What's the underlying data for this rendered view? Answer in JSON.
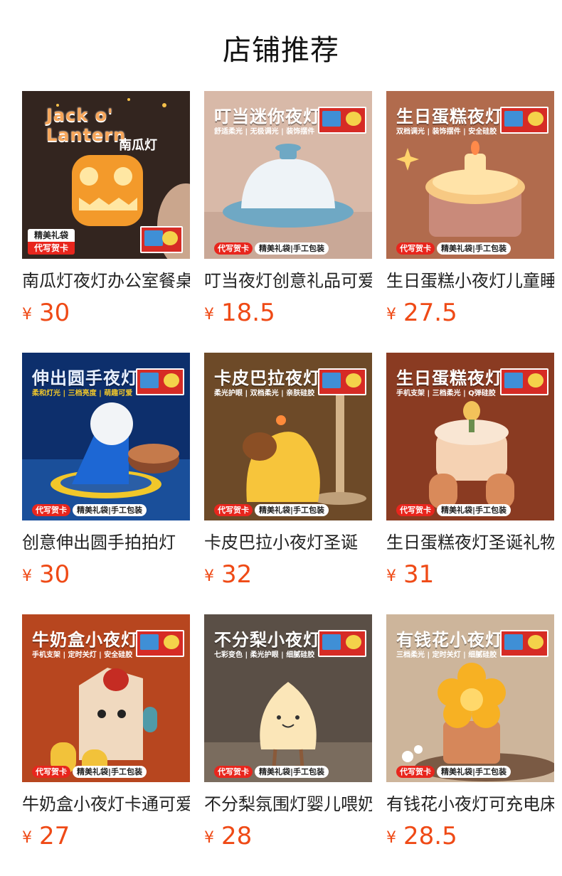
{
  "page": {
    "title": "店铺推荐"
  },
  "common": {
    "currency": "¥",
    "tag_red": "代写贺卡",
    "tag_white": "精美礼袋|手工包装",
    "tag1_top": "精美礼袋",
    "tag1_bottom": "代写贺卡"
  },
  "products": [
    {
      "name": "南瓜灯夜灯办公室餐桌",
      "price": "30",
      "headline": "Jack o' Lantern",
      "subline": "南瓜灯",
      "colors": {
        "bg": "#3a2a22",
        "accent": "#f39a2b"
      }
    },
    {
      "name": "叮当夜灯创意礼品可爱",
      "price": "18.5",
      "headline": "叮当迷你夜灯",
      "subline": "舒适柔光 | 无极调光 | 装饰摆件",
      "colors": {
        "bg": "#d9b7a6",
        "accent": "#6fa8c4"
      }
    },
    {
      "name": "生日蛋糕小夜灯儿童睡",
      "price": "27.5",
      "headline": "生日蛋糕夜灯",
      "subline": "双档调光 | 装饰摆件 | 安全硅胶",
      "colors": {
        "bg": "#b36a4b",
        "accent": "#f7c983"
      }
    },
    {
      "name": "创意伸出圆手拍拍灯",
      "price": "30",
      "headline": "伸出圆手夜灯",
      "subline": "柔和灯光 | 三档亮度 | 萌趣可爱",
      "colors": {
        "bg": "#0e2f6b",
        "accent": "#1d67d4"
      }
    },
    {
      "name": "卡皮巴拉小夜灯圣诞",
      "price": "32",
      "headline": "卡皮巴拉夜灯",
      "subline": "柔光护眼 | 双档柔光 | 亲肤硅胶",
      "colors": {
        "bg": "#6e4a25",
        "accent": "#f3c23b"
      }
    },
    {
      "name": "生日蛋糕夜灯圣诞礼物",
      "price": "31",
      "headline": "生日蛋糕夜灯",
      "subline": "手机支架 | 三档柔光 | Q弹硅胶",
      "colors": {
        "bg": "#8a3a22",
        "accent": "#f5d2b3"
      }
    },
    {
      "name": "牛奶盒小夜灯卡通可爱",
      "price": "27",
      "headline": "牛奶盒小夜灯",
      "subline": "手机支架 | 定时关灯 | 安全硅胶",
      "colors": {
        "bg": "#b8471f",
        "accent": "#f2dcc0"
      }
    },
    {
      "name": "不分梨氛围灯婴儿喂奶",
      "price": "28",
      "headline": "不分梨小夜灯",
      "subline": "七彩变色 | 柔光护眼 | 细腻硅胶",
      "colors": {
        "bg": "#5d5146",
        "accent": "#fbe6b8"
      }
    },
    {
      "name": "有钱花小夜灯可充电床",
      "price": "28.5",
      "headline": "有钱花小夜灯",
      "subline": "三档柔光 | 定时关灯 | 细腻硅胶",
      "colors": {
        "bg": "#c9b29a",
        "accent": "#f7b123"
      }
    }
  ]
}
